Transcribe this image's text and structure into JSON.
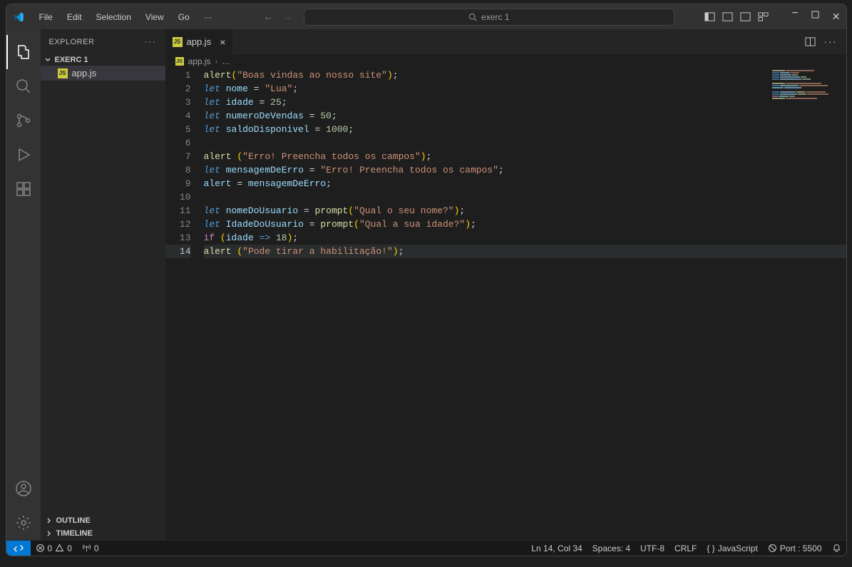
{
  "menu": {
    "file": "File",
    "edit": "Edit",
    "selection": "Selection",
    "view": "View",
    "go": "Go",
    "more": "···"
  },
  "search": {
    "text": "exerc 1"
  },
  "explorer": {
    "title": "EXPLORER",
    "project": "EXERC 1",
    "file": "app.js",
    "outline": "OUTLINE",
    "timeline": "TIMELINE"
  },
  "tab": {
    "name": "app.js"
  },
  "breadcrumb": {
    "file": "app.js",
    "more": "..."
  },
  "status": {
    "errors": "0",
    "warnings": "0",
    "ports": "0",
    "lncol": "Ln 14, Col 34",
    "spaces": "Spaces: 4",
    "encoding": "UTF-8",
    "eol": "CRLF",
    "lang": "JavaScript",
    "port": "Port : 5500"
  },
  "code_lines": [
    [
      [
        "fn",
        "alert"
      ],
      [
        "par",
        "("
      ],
      [
        "str",
        "\"Boas vindas ao nosso site\""
      ],
      [
        "par",
        ")"
      ],
      [
        "op",
        ";"
      ]
    ],
    [
      [
        "kw",
        "let"
      ],
      [
        "op",
        " "
      ],
      [
        "var",
        "nome"
      ],
      [
        "op",
        " = "
      ],
      [
        "str",
        "\"Lua\""
      ],
      [
        "op",
        ";"
      ]
    ],
    [
      [
        "kw",
        "let"
      ],
      [
        "op",
        " "
      ],
      [
        "var",
        "idade"
      ],
      [
        "op",
        " = "
      ],
      [
        "num",
        "25"
      ],
      [
        "op",
        ";"
      ]
    ],
    [
      [
        "kw",
        "let"
      ],
      [
        "op",
        " "
      ],
      [
        "var",
        "numeroDeVendas"
      ],
      [
        "op",
        " = "
      ],
      [
        "num",
        "50"
      ],
      [
        "op",
        ";"
      ]
    ],
    [
      [
        "kw",
        "let"
      ],
      [
        "op",
        " "
      ],
      [
        "var",
        "saldoDisponivel"
      ],
      [
        "op",
        " = "
      ],
      [
        "num",
        "1000"
      ],
      [
        "op",
        ";"
      ]
    ],
    [],
    [
      [
        "fn",
        "alert"
      ],
      [
        "op",
        " "
      ],
      [
        "par",
        "("
      ],
      [
        "str",
        "\"Erro! Preencha todos os campos\""
      ],
      [
        "par",
        ")"
      ],
      [
        "op",
        ";"
      ]
    ],
    [
      [
        "kw",
        "let"
      ],
      [
        "op",
        " "
      ],
      [
        "var",
        "mensagemDeErro"
      ],
      [
        "op",
        " = "
      ],
      [
        "str",
        "\"Erro! Preencha todos os campos\""
      ],
      [
        "op",
        ";"
      ]
    ],
    [
      [
        "var",
        "alert"
      ],
      [
        "op",
        " = "
      ],
      [
        "var",
        "mensagemDeErro"
      ],
      [
        "op",
        ";"
      ]
    ],
    [],
    [
      [
        "kw",
        "let"
      ],
      [
        "op",
        " "
      ],
      [
        "var",
        "nomeDoUsuario"
      ],
      [
        "op",
        " = "
      ],
      [
        "fn",
        "prompt"
      ],
      [
        "par",
        "("
      ],
      [
        "str",
        "\"Qual o seu nome?\""
      ],
      [
        "par",
        ")"
      ],
      [
        "op",
        ";"
      ]
    ],
    [
      [
        "kw",
        "let"
      ],
      [
        "op",
        " "
      ],
      [
        "var",
        "IdadeDoUsuario"
      ],
      [
        "op",
        " = "
      ],
      [
        "fn",
        "prompt"
      ],
      [
        "par",
        "("
      ],
      [
        "str",
        "\"Qual a sua idade?\""
      ],
      [
        "par",
        ")"
      ],
      [
        "op",
        ";"
      ]
    ],
    [
      [
        "kw2",
        "if"
      ],
      [
        "op",
        " "
      ],
      [
        "par",
        "("
      ],
      [
        "var",
        "idade"
      ],
      [
        "op",
        " "
      ],
      [
        "kw",
        "=>"
      ],
      [
        "op",
        " "
      ],
      [
        "num",
        "18"
      ],
      [
        "par",
        ")"
      ],
      [
        "op",
        ";"
      ]
    ],
    [
      [
        "fn",
        "alert"
      ],
      [
        "op",
        " "
      ],
      [
        "par",
        "("
      ],
      [
        "str",
        "\"Pode tirar a habilitação!\""
      ],
      [
        "par",
        ")"
      ],
      [
        "op",
        ";"
      ]
    ]
  ],
  "highlighted_line": 14
}
